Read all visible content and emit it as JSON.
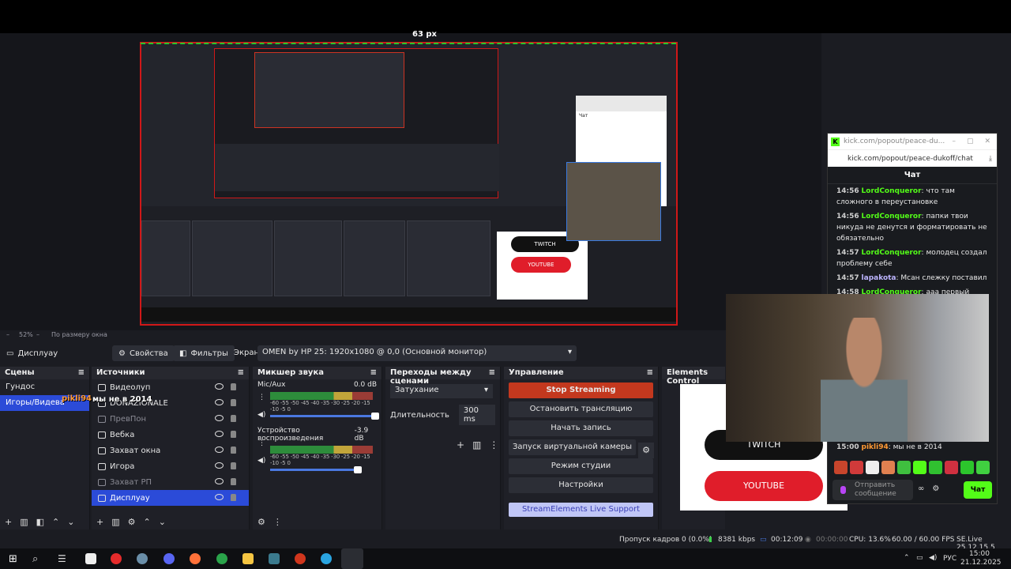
{
  "preview": {
    "dimension_label": "63 px",
    "zoom": "52%",
    "fit_mode": "По размеру окна"
  },
  "kick": {
    "window_title": "kick.com/popout/peace-du...",
    "url": "kick.com/popout/peace-dukoff/chat",
    "chat_title": "Чат",
    "messages": [
      {
        "time": "14:56",
        "user": "LordConqueror",
        "text": ": что там сложного в переустановке"
      },
      {
        "time": "14:56",
        "user": "LordConqueror",
        "text": ": папки твои никуда не денутся и форматировать не обязательно"
      },
      {
        "time": "14:57",
        "user": "LordConqueror",
        "text": ": молодец создал проблему себе"
      },
      {
        "time": "14:57",
        "user": "lapakota",
        "text": ": Мсан слежку поставил"
      },
      {
        "time": "14:58",
        "user": "LordConqueror",
        "text": ": ааа первый сайт в"
      },
      {
        "time": "15:00",
        "user": "pikli94",
        "text": ": мы не в 2014"
      }
    ],
    "input_placeholder": "Отправить сообщение",
    "send_label": "Чат"
  },
  "obs_bar": {
    "properties": "Свойства",
    "filters": "Фильтры",
    "screen_label": "Экран",
    "screen_value": "OMEN by HP 25: 1920x1080 @ 0,0 (Основной монитор)"
  },
  "scenes": {
    "title": "Сцены",
    "items": [
      "Гундос",
      "Игоры/Видева"
    ]
  },
  "sources": {
    "title": "Источники",
    "items": [
      "Видеолуп",
      "DONAZIONALE",
      "ПревПон",
      "Вебка",
      "Захват окна",
      "Игора",
      "Захват РП",
      "Дисплуау"
    ]
  },
  "overlay": {
    "user": "pikli94",
    "text": "мы не в 2014"
  },
  "mixer": {
    "title": "Микшер звука",
    "channels": [
      {
        "name": "Mic/Aux",
        "db": "0.0 dB"
      },
      {
        "name": "Устройство воспроизведения",
        "db": "-3.9 dB"
      }
    ],
    "ticks": "-60 -55 -50 -45 -40 -35 -30 -25 -20 -15 -10 -5 0"
  },
  "transitions": {
    "title": "Переходы между сценами",
    "selected": "Затухание",
    "duration_label": "Длительность",
    "duration_value": "300 ms"
  },
  "controls": {
    "title": "Управление",
    "stop_streaming": "Stop Streaming",
    "stop_broadcast": "Остановить трансляцию",
    "start_recording": "Начать запись",
    "virtual_camera": "Запуск виртуальной камеры",
    "studio_mode": "Режим студии",
    "settings": "Настройки",
    "support": "StreamElements Live Support"
  },
  "elements": {
    "title": "Elements Control",
    "twitch": "TWITCH",
    "youtube": "YOUTUBE"
  },
  "status": {
    "dropped": "Пропуск кадров 0 (0.0%)",
    "bitrate": "8381 kbps",
    "stream_time": "00:12:09",
    "rec_time": "00:00:00",
    "cpu": "CPU: 13.6%",
    "fps": "60.00 / 60.00 FPS",
    "version": "SE.Live 25.12.15.5"
  },
  "taskbar": {
    "lang": "РУС",
    "time": "15:00",
    "date": "21.12.2025"
  }
}
